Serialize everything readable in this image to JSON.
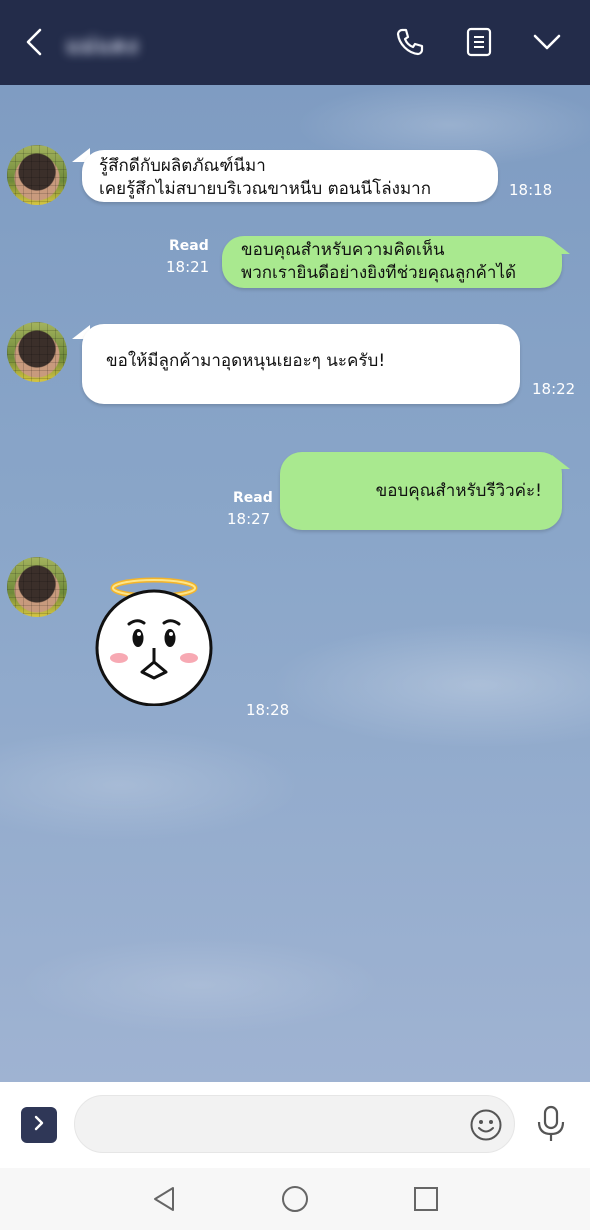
{
  "header": {
    "contact_name": "แม่แดง",
    "icons": [
      "back-arrow-icon",
      "phone-icon",
      "notes-icon",
      "chevron-down-icon"
    ]
  },
  "messages": [
    {
      "from": "contact",
      "lines": [
        "รู้สึกดีกับผลิตภัณฑ์นีมา",
        "เคยรู้สึกไม่สบายบริเวณขาหนีบ ตอนนีโล่งมาก"
      ],
      "time": "18:18"
    },
    {
      "from": "me",
      "status": "Read",
      "lines": [
        "ขอบคุณสําหรับความคิดเห็น",
        "พวกเรายินดีอย่างยิงทีช่วยคุณลูกค้าได้"
      ],
      "time": "18:21"
    },
    {
      "from": "contact",
      "lines": [
        "ขอให้มีลูกค้ามาอุดหนุนเยอะๆ นะครับ!"
      ],
      "time": "18:22"
    },
    {
      "from": "me",
      "status": "Read",
      "lines": [
        "ขอบคุณสําหรับรีวิวค่ะ!"
      ],
      "time": "18:27"
    },
    {
      "from": "contact",
      "sticker": "angel-sticker",
      "time": "18:28"
    }
  ],
  "composer": {
    "placeholder": "",
    "icons": [
      "expand-arrow-icon",
      "emoji-icon",
      "microphone-icon"
    ]
  },
  "navbar": {
    "icons": [
      "back-triangle-icon",
      "home-circle-icon",
      "recents-square-icon"
    ]
  },
  "colors": {
    "header": "#232c4a",
    "incoming_bubble": "#ffffff",
    "outgoing_bubble": "#a9e98f",
    "chat_bg": "#8aa6c9"
  }
}
